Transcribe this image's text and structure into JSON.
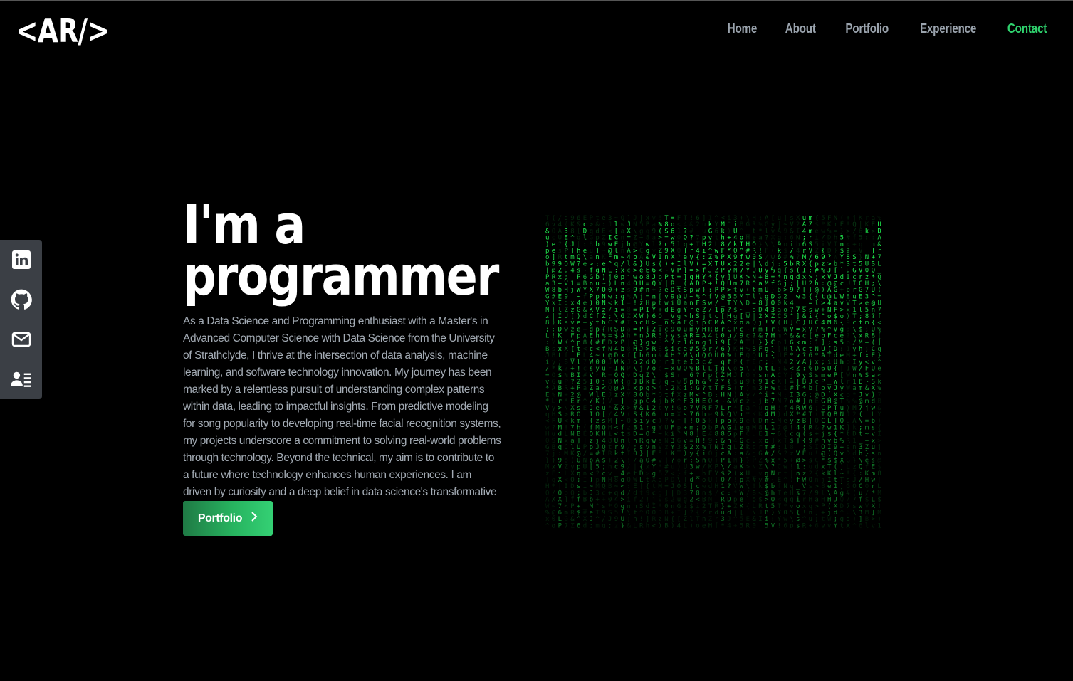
{
  "header": {
    "logo": "<AR/>",
    "nav": [
      {
        "label": "Home",
        "active": false
      },
      {
        "label": "About",
        "active": false
      },
      {
        "label": "Portfolio",
        "active": false
      },
      {
        "label": "Experience",
        "active": false
      },
      {
        "label": "Contact",
        "active": true
      }
    ]
  },
  "social": {
    "icons": [
      "linkedin-icon",
      "github-icon",
      "mail-icon",
      "resume-icon"
    ]
  },
  "hero": {
    "title_line1": "I'm a",
    "title_line2": "programmer",
    "description": "As a Data Science and Programming enthusiast with a Master's in Advanced Computer Science with Data Science from the University of Strathclyde, I thrive at the intersection of data analysis, machine learning, and software technology innovation. My journey has been marked by a relentless pursuit of understanding complex patterns within data, leading to impactful insights. From predictive modeling for song popularity to developing real-time facial recognition systems, my projects underscore a commitment to solving real-world problems through technology. Beyond the technical, my aim is to contribute to a future where technology enhances human experiences. I am driven by curiosity and a deep belief in data science's transformative power.",
    "cta_label": "Portfolio",
    "cta_icon": "chevron-right-icon"
  },
  "colors": {
    "background": "#000000",
    "accent": "#2fd36e",
    "nav_text": "#9aa3ad",
    "matrix_green": "#22ff55"
  }
}
